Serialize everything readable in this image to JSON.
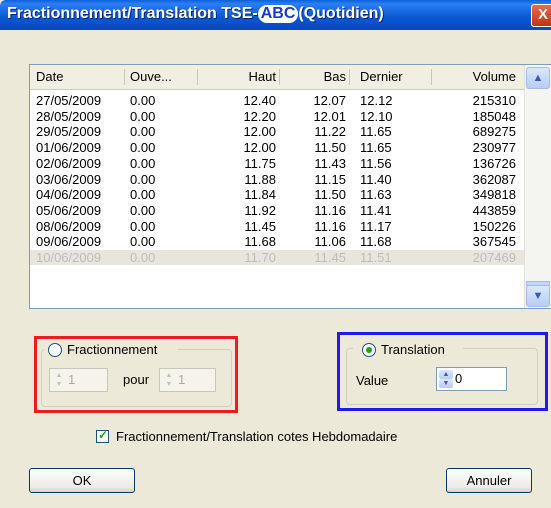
{
  "window": {
    "title_prefix": "Fractionnement/Translation TSE-",
    "title_highlight": "ABC",
    "title_suffix": "(Quotidien)",
    "close_glyph": "X"
  },
  "table": {
    "columns": [
      "Date",
      "Ouve...",
      "Haut",
      "Bas",
      "Dernier",
      "Volume"
    ],
    "rows": [
      [
        "27/05/2009",
        "0.00",
        "12.40",
        "12.07",
        "12.12",
        "215310"
      ],
      [
        "28/05/2009",
        "0.00",
        "12.20",
        "12.01",
        "12.10",
        "185048"
      ],
      [
        "29/05/2009",
        "0.00",
        "12.00",
        "11.22",
        "11.65",
        "689275"
      ],
      [
        "01/06/2009",
        "0.00",
        "12.00",
        "11.50",
        "11.65",
        "230977"
      ],
      [
        "02/06/2009",
        "0.00",
        "11.75",
        "11.43",
        "11.56",
        "136726"
      ],
      [
        "03/06/2009",
        "0.00",
        "11.88",
        "11.15",
        "11.40",
        "362087"
      ],
      [
        "04/06/2009",
        "0.00",
        "11.84",
        "11.50",
        "11.63",
        "349818"
      ],
      [
        "05/06/2009",
        "0.00",
        "11.92",
        "11.16",
        "11.41",
        "443859"
      ],
      [
        "08/06/2009",
        "0.00",
        "11.45",
        "11.16",
        "11.17",
        "150226"
      ],
      [
        "09/06/2009",
        "0.00",
        "11.68",
        "11.06",
        "11.68",
        "367545"
      ],
      [
        "10/06/2009",
        "0.00",
        "11.70",
        "11.45",
        "11.51",
        "207469"
      ]
    ],
    "disabled_row_index": 10
  },
  "fractionnement": {
    "label": "Fractionnement",
    "selected": false,
    "value_left": "1",
    "pour_label": "pour",
    "value_right": "1"
  },
  "translation": {
    "label": "Translation",
    "selected": true,
    "value_label": "Value",
    "value": "0"
  },
  "weekly_checkbox": {
    "label": "Fractionnement/Translation cotes Hebdomadaire",
    "checked": true
  },
  "buttons": {
    "ok": "OK",
    "cancel": "Annuler"
  },
  "colors": {
    "title_bar": "#0b5ad7",
    "highlight_red": "#ee1c1c",
    "highlight_blue": "#1c1cf0",
    "check_green": "#21a121"
  }
}
